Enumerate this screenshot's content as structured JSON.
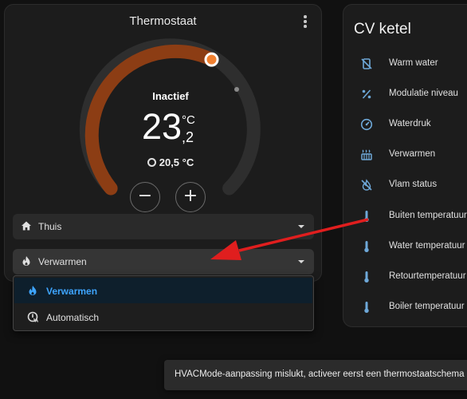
{
  "thermostat": {
    "title": "Thermostaat",
    "hvac_action": "Inactief",
    "target_temperature": "23",
    "target_decimal": ",2",
    "unit": "°C",
    "current_temperature": "20,5 °C",
    "minus_label": "−",
    "plus_label": "+",
    "preset": {
      "label": "Thuis",
      "icon": "home-icon"
    },
    "hvac_mode": {
      "label": "Verwarmen",
      "icon": "fire-icon"
    },
    "dropdown_options": [
      {
        "label": "Verwarmen",
        "icon": "fire-icon",
        "selected": true
      },
      {
        "label": "Automatisch",
        "icon": "thermostat-auto-icon",
        "selected": false
      }
    ],
    "colors": {
      "arc": "#8c3d14",
      "track": "#2e2e2e",
      "accent": "#3ea5ff",
      "knob": "#f08030"
    }
  },
  "cv_ketel": {
    "title": "CV ketel",
    "entities": [
      {
        "label": "Warm water",
        "icon": "water-boiler-off-icon"
      },
      {
        "label": "Modulatie niveau",
        "icon": "percent-icon"
      },
      {
        "label": "Waterdruk",
        "icon": "gauge-icon"
      },
      {
        "label": "Verwarmen",
        "icon": "radiator-icon"
      },
      {
        "label": "Vlam status",
        "icon": "fire-off-icon"
      },
      {
        "label": "Buiten temperatuur",
        "icon": "thermometer-icon"
      },
      {
        "label": "Water temperatuur",
        "icon": "thermometer-icon"
      },
      {
        "label": "Retourtemperatuur",
        "icon": "thermometer-icon"
      },
      {
        "label": "Boiler temperatuur",
        "icon": "thermometer-icon"
      }
    ],
    "icon_color": "#6ea8d8"
  },
  "toast": {
    "message": "HVACMode-aanpassing mislukt, activeer eerst een thermostaatschema"
  },
  "annotation": {
    "arrow_color": "#e01e1e"
  }
}
